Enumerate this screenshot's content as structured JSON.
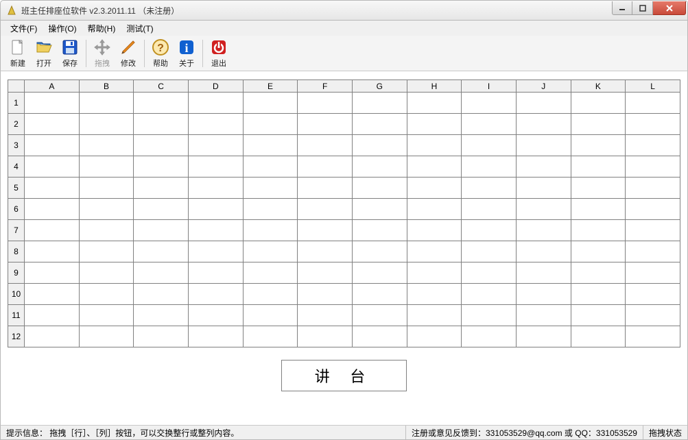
{
  "window": {
    "title": "班主任排座位软件 v2.3.2011.11 （未注册）"
  },
  "menu": {
    "file": "文件(F)",
    "operate": "操作(O)",
    "help": "帮助(H)",
    "test": "测试(T)"
  },
  "toolbar": {
    "new": "新建",
    "open": "打开",
    "save": "保存",
    "drag": "拖拽",
    "edit": "修改",
    "help": "帮助",
    "about": "关于",
    "exit": "退出"
  },
  "grid": {
    "columns": [
      "A",
      "B",
      "C",
      "D",
      "E",
      "F",
      "G",
      "H",
      "I",
      "J",
      "K",
      "L"
    ],
    "rows": [
      "1",
      "2",
      "3",
      "4",
      "5",
      "6",
      "7",
      "8",
      "9",
      "10",
      "11",
      "12"
    ]
  },
  "podium": "讲 台",
  "status": {
    "hint": "提示信息：  拖拽［行］、［列］按钮，可以交换整行或整列内容。",
    "register": "注册或意见反馈到：331053529@qq.com 或 QQ：331053529",
    "drag_state": "拖拽状态"
  },
  "colors": {
    "close_button": "#c84a3a",
    "save_icon": "#1e58c9",
    "help_icon": "#f0a030",
    "about_bg": "#1060d0",
    "exit_bg": "#d02020",
    "pencil": "#f09020"
  }
}
